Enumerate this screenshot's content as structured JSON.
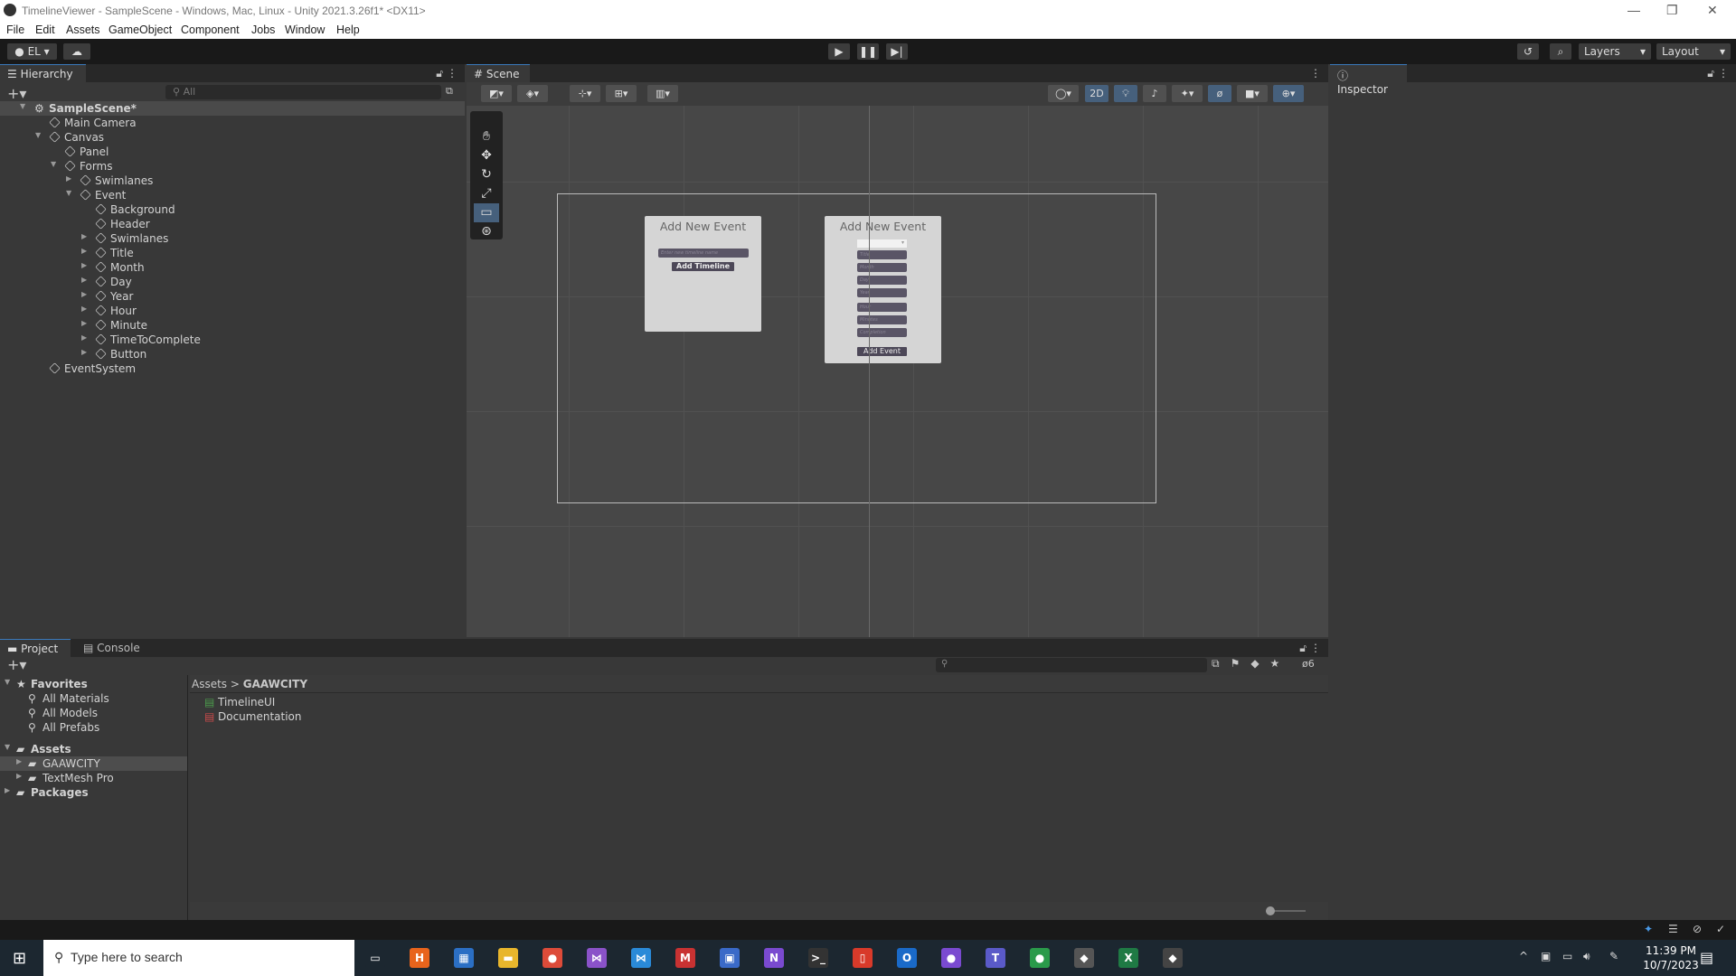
{
  "window": {
    "title": "TimelineViewer - SampleScene - Windows, Mac, Linux - Unity 2021.3.26f1* <DX11>"
  },
  "menu": [
    "File",
    "Edit",
    "Assets",
    "GameObject",
    "Component",
    "Jobs",
    "Window",
    "Help"
  ],
  "toolbar": {
    "account": "EL",
    "layers": "Layers",
    "layout": "Layout"
  },
  "hierarchy": {
    "tab": "Hierarchy",
    "search_placeholder": "All",
    "items": [
      {
        "label": "SampleScene*",
        "depth": 0,
        "arrow": "open",
        "scene": true
      },
      {
        "label": "Main Camera",
        "depth": 1,
        "arrow": ""
      },
      {
        "label": "Canvas",
        "depth": 1,
        "arrow": "open"
      },
      {
        "label": "Panel",
        "depth": 2,
        "arrow": ""
      },
      {
        "label": "Forms",
        "depth": 2,
        "arrow": "open"
      },
      {
        "label": "Swimlanes",
        "depth": 3,
        "arrow": "closed"
      },
      {
        "label": "Event",
        "depth": 3,
        "arrow": "open"
      },
      {
        "label": "Background",
        "depth": 4,
        "arrow": ""
      },
      {
        "label": "Header",
        "depth": 4,
        "arrow": ""
      },
      {
        "label": "Swimlanes",
        "depth": 4,
        "arrow": "closed"
      },
      {
        "label": "Title",
        "depth": 4,
        "arrow": "closed"
      },
      {
        "label": "Month",
        "depth": 4,
        "arrow": "closed"
      },
      {
        "label": "Day",
        "depth": 4,
        "arrow": "closed"
      },
      {
        "label": "Year",
        "depth": 4,
        "arrow": "closed"
      },
      {
        "label": "Hour",
        "depth": 4,
        "arrow": "closed"
      },
      {
        "label": "Minute",
        "depth": 4,
        "arrow": "closed"
      },
      {
        "label": "TimeToComplete",
        "depth": 4,
        "arrow": "closed"
      },
      {
        "label": "Button",
        "depth": 4,
        "arrow": "closed"
      },
      {
        "label": "EventSystem",
        "depth": 1,
        "arrow": ""
      }
    ]
  },
  "scene": {
    "tab": "Scene",
    "mode_2d": "2D",
    "form1": {
      "heading": "Add New Event",
      "input_placeholder": "Enter new timeline name",
      "button": "Add Timeline"
    },
    "form2": {
      "heading": "Add New Event",
      "fields": [
        "Title",
        "Month",
        "Day",
        "Year",
        "Hour",
        "Minutes",
        "Completion"
      ],
      "button": "Add Event"
    }
  },
  "inspector": {
    "tab": "Inspector"
  },
  "project": {
    "tabs": [
      "Project",
      "Console"
    ],
    "hidden_count": "6",
    "tree": [
      {
        "label": "Favorites",
        "kind": "header"
      },
      {
        "label": "All Materials",
        "kind": "search"
      },
      {
        "label": "All Models",
        "kind": "search"
      },
      {
        "label": "All Prefabs",
        "kind": "search"
      },
      {
        "label": "Assets",
        "kind": "header"
      },
      {
        "label": "GAAWCITY",
        "kind": "folder",
        "selected": true
      },
      {
        "label": "TextMesh Pro",
        "kind": "folder"
      },
      {
        "label": "Packages",
        "kind": "header"
      }
    ],
    "breadcrumb": [
      "Assets",
      "GAAWCITY"
    ],
    "files": [
      "TimelineUI",
      "Documentation"
    ]
  },
  "taskbar": {
    "search_placeholder": "Type here to search",
    "time": "11:39 PM",
    "date": "10/7/2023",
    "apps": [
      {
        "name": "task-view",
        "color": "#1c2730",
        "glyph": "▭"
      },
      {
        "name": "h-app",
        "color": "#e8641c",
        "glyph": "H"
      },
      {
        "name": "store",
        "color": "#2b6fc4",
        "glyph": "▦"
      },
      {
        "name": "file-explorer",
        "color": "#e8b62c",
        "glyph": "▬"
      },
      {
        "name": "chrome",
        "color": "#dd4b39",
        "glyph": "●"
      },
      {
        "name": "visual-studio",
        "color": "#8a52c8",
        "glyph": "⋈"
      },
      {
        "name": "vscode",
        "color": "#2a8ad8",
        "glyph": "⋈"
      },
      {
        "name": "app-red",
        "color": "#c83232",
        "glyph": "M"
      },
      {
        "name": "app-blue",
        "color": "#3a6ac8",
        "glyph": "▣"
      },
      {
        "name": "visual-studio-2",
        "color": "#7a4ad0",
        "glyph": "N"
      },
      {
        "name": "terminal",
        "color": "#333",
        "glyph": ">_"
      },
      {
        "name": "pdf",
        "color": "#d83a2a",
        "glyph": "▯"
      },
      {
        "name": "outlook",
        "color": "#1a6ac8",
        "glyph": "O"
      },
      {
        "name": "github",
        "color": "#7a4ad0",
        "glyph": "●"
      },
      {
        "name": "teams",
        "color": "#5a5ac8",
        "glyph": "T"
      },
      {
        "name": "chrome-2",
        "color": "#2a9a4a",
        "glyph": "●"
      },
      {
        "name": "unity-hub",
        "color": "#555",
        "glyph": "◆"
      },
      {
        "name": "excel",
        "color": "#1f7a44",
        "glyph": "X"
      },
      {
        "name": "unity",
        "color": "#444",
        "glyph": "◆"
      }
    ]
  },
  "colors": {
    "accent": "#3a79bb",
    "selected_toggle": "#46607c",
    "form_bg": "#d5d5d5",
    "field_bg": "#5a5566"
  }
}
